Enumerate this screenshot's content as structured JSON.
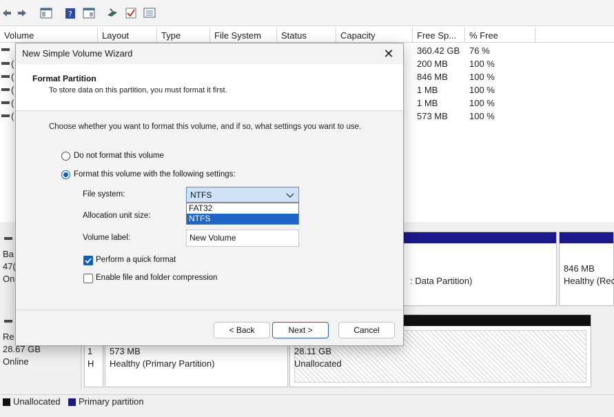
{
  "volume_list": {
    "columns": [
      "Volume",
      "Layout",
      "Type",
      "File System",
      "Status",
      "Capacity",
      "Free Sp...",
      "% Free"
    ],
    "rows": [
      {
        "volume": "",
        "free_space": "360.42 GB",
        "percent_free": "76 %"
      },
      {
        "volume": "(",
        "free_space": "200 MB",
        "percent_free": "100 %"
      },
      {
        "volume": "(",
        "free_space": "846 MB",
        "percent_free": "100 %"
      },
      {
        "volume": "(",
        "free_space": "1 MB",
        "percent_free": "100 %"
      },
      {
        "volume": "(",
        "free_space": "1 MB",
        "percent_free": "100 %"
      },
      {
        "volume": "(",
        "free_space": "573 MB",
        "percent_free": "100 %"
      }
    ]
  },
  "disk_view": {
    "disk0": {
      "info_line1": "Ba",
      "info_line2": "47(",
      "info_line3": "On"
    },
    "disk0_partition_right": {
      "size": "846 MB",
      "status": "Healthy (Rec"
    },
    "disk0_partition_mid": {
      "status": ": Data Partition)"
    },
    "disk1": {
      "info_line1": "Re",
      "info_line2": "28.67 GB",
      "info_line3": "Online"
    },
    "disk1_partition_a": {
      "line1": "1",
      "line2": "H"
    },
    "disk1_partition_b": {
      "size": "573 MB",
      "status": "Healthy (Primary Partition)"
    },
    "disk1_partition_c": {
      "size": "28.11 GB",
      "status": "Unallocated"
    }
  },
  "legend": {
    "items": [
      {
        "label": "Unallocated",
        "color": "#111111"
      },
      {
        "label": "Primary partition",
        "color": "#1a1a8c"
      }
    ]
  },
  "wizard": {
    "title": "New Simple Volume Wizard",
    "close_glyph": "✕",
    "heading": "Format Partition",
    "subheading": "To store data on this partition, you must format it first.",
    "instruction": "Choose whether you want to format this volume, and if so, what settings you want to use.",
    "option_no_format": "Do not format this volume",
    "option_format": "Format this volume with the following settings:",
    "file_system_label": "File system:",
    "file_system_value": "NTFS",
    "file_system_options": [
      "FAT32",
      "NTFS"
    ],
    "allocation_label": "Allocation unit size:",
    "volume_label_label": "Volume label:",
    "volume_label_value": "New Volume",
    "quick_format_label": "Perform a quick format",
    "quick_format_checked": true,
    "compression_label": "Enable file and folder compression",
    "compression_checked": false,
    "back_button": "< Back",
    "next_button": "Next >",
    "cancel_button": "Cancel",
    "accent_color": "#0a5ec2"
  }
}
